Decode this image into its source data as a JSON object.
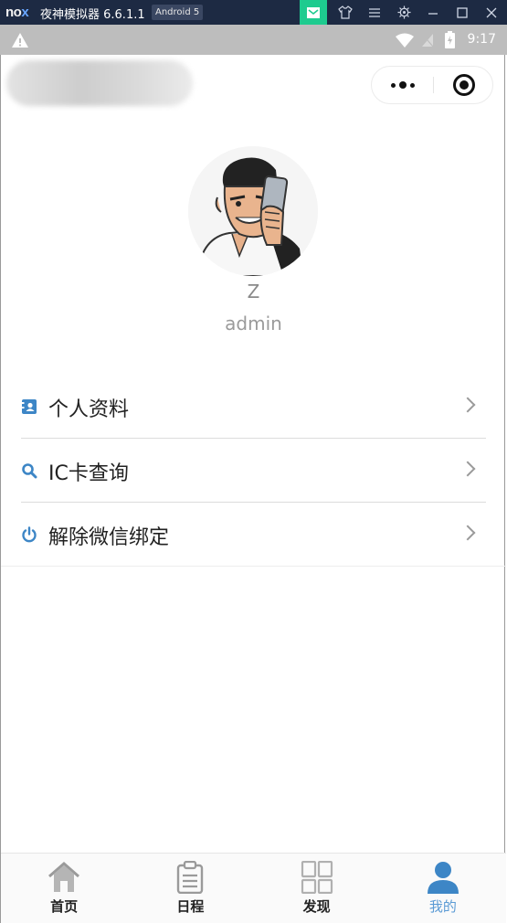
{
  "emulator": {
    "logo_n": "no",
    "logo_x": "x",
    "title": "夜神模拟器 6.6.1.1",
    "badge": "Android 5"
  },
  "status_bar": {
    "time": "9:17"
  },
  "capsule": {
    "more_icon": "ellipsis-icon",
    "close_icon": "target-icon"
  },
  "profile": {
    "name": "Z",
    "account": "admin"
  },
  "menu": [
    {
      "label": "个人资料",
      "icon": "contact-card-icon"
    },
    {
      "label": "IC卡查询",
      "icon": "search-icon"
    },
    {
      "label": "解除微信绑定",
      "icon": "power-icon"
    }
  ],
  "tabs": [
    {
      "label": "首页",
      "icon": "home-icon"
    },
    {
      "label": "日程",
      "icon": "clipboard-icon"
    },
    {
      "label": "发现",
      "icon": "grid-icon"
    },
    {
      "label": "我的",
      "icon": "user-icon",
      "active": true
    }
  ],
  "colors": {
    "accent": "#5b9bd5",
    "emulator_bar": "#1d2a43",
    "status_bar": "#bdbdbd"
  }
}
